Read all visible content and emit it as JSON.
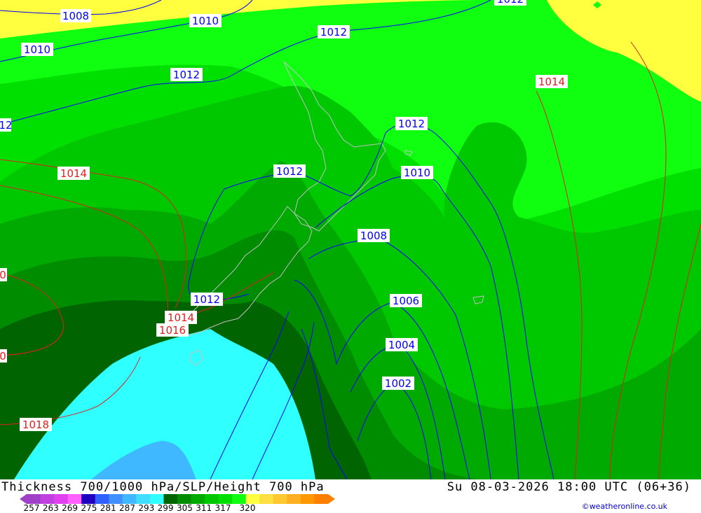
{
  "footer": {
    "title": "Thickness 700/1000 hPa/SLP/Height 700 hPa",
    "datetime": "Su 08-03-2026 18:00 UTC (06+36)",
    "credit": "©weatheronline.co.uk"
  },
  "legend": {
    "ticks": [
      "257",
      "263",
      "269",
      "275",
      "281",
      "287",
      "293",
      "299",
      "305",
      "311",
      "317",
      "320"
    ],
    "colors": [
      "#a040c8",
      "#c040e0",
      "#e040f0",
      "#ff60ff",
      "#2000c0",
      "#3060ff",
      "#4090ff",
      "#40b8ff",
      "#40ddff",
      "#30ffff",
      "#006400",
      "#008c00",
      "#00aa00",
      "#00c800",
      "#00e000",
      "#10ff10",
      "#ffff40",
      "#ffe040",
      "#ffc830",
      "#ffb020",
      "#ff9800",
      "#ff8000"
    ]
  },
  "isobars": {
    "blue": [
      "1008",
      "1010",
      "1010",
      "1012",
      "1012",
      "1012",
      "1012",
      "1012",
      "1012",
      "1010",
      "1008",
      "1006",
      "1004",
      "1002"
    ],
    "red": [
      "1014",
      "1014",
      "1014",
      "1016",
      "1018",
      "0",
      "0"
    ],
    "edge_blue": "12"
  },
  "colors": {
    "yellow": "#ffff40",
    "green_light": "#10ff10",
    "green_mid": "#00e000",
    "green_dark": "#00c800",
    "green_darker": "#00aa00",
    "green_deep": "#008c00",
    "green_deepest": "#006400",
    "cyan": "#30ffff",
    "blue_light": "#40b8ff",
    "isobar_blue": "#0000ff",
    "isobar_red": "#e02020",
    "coast": "#c0c0c0"
  }
}
